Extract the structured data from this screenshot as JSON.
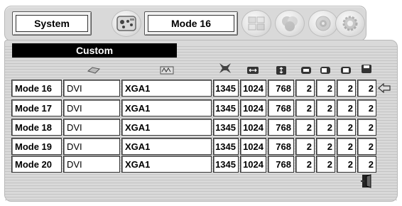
{
  "toolbar": {
    "system_label": "System",
    "mode_label": "Mode 16",
    "icons": [
      "computer-input-icon",
      "pc-adjust-icon",
      "color-adjust-icon",
      "sound-icon",
      "setting-icon"
    ]
  },
  "custom": {
    "header": "Custom",
    "column_icons": [
      "input-icon",
      "signal-icon",
      "total-dots-icon",
      "horizontal-icon",
      "vertical-icon",
      "sync-1-icon",
      "sync-2-icon",
      "sync-3-icon",
      "memory-icon"
    ],
    "rows": [
      {
        "mode": "Mode 16",
        "input": "DVI",
        "signal": "XGA1",
        "total_dots": "1345",
        "horizontal": "1024",
        "vertical": "768",
        "v1": "2",
        "v2": "2",
        "v3": "2",
        "v4": "2",
        "selected": true
      },
      {
        "mode": "Mode 17",
        "input": "DVI",
        "signal": "XGA1",
        "total_dots": "1345",
        "horizontal": "1024",
        "vertical": "768",
        "v1": "2",
        "v2": "2",
        "v3": "2",
        "v4": "2"
      },
      {
        "mode": "Mode 18",
        "input": "DVI",
        "signal": "XGA1",
        "total_dots": "1345",
        "horizontal": "1024",
        "vertical": "768",
        "v1": "2",
        "v2": "2",
        "v3": "2",
        "v4": "2"
      },
      {
        "mode": "Mode 19",
        "input": "DVI",
        "signal": "XGA1",
        "total_dots": "1345",
        "horizontal": "1024",
        "vertical": "768",
        "v1": "2",
        "v2": "2",
        "v3": "2",
        "v4": "2"
      },
      {
        "mode": "Mode 20",
        "input": "DVI",
        "signal": "XGA1",
        "total_dots": "1345",
        "horizontal": "1024",
        "vertical": "768",
        "v1": "2",
        "v2": "2",
        "v3": "2",
        "v4": "2"
      }
    ],
    "exit_icon": "exit-icon"
  }
}
